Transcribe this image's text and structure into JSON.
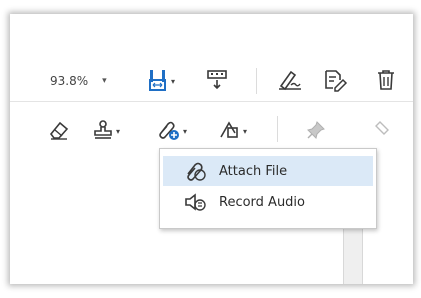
{
  "toolbar": {
    "zoom_value": "93.8%",
    "zoom_caret": "▾",
    "tools_row1": [
      "page-layout",
      "redact",
      "sign",
      "edit-pdf",
      "delete"
    ],
    "tools_row2": [
      "eraser",
      "stamp",
      "attach",
      "shape",
      "pin",
      "clear"
    ],
    "dropdown_glyph": "▾"
  },
  "attach_menu": {
    "items": [
      {
        "label": "Attach File",
        "icon": "paperclip-icon"
      },
      {
        "label": "Record Audio",
        "icon": "speaker-icon"
      }
    ]
  },
  "colors": {
    "icon_blue": "#1f6fc5",
    "icon_gray": "#3a3a3a",
    "hover": "#dbe9f7"
  }
}
